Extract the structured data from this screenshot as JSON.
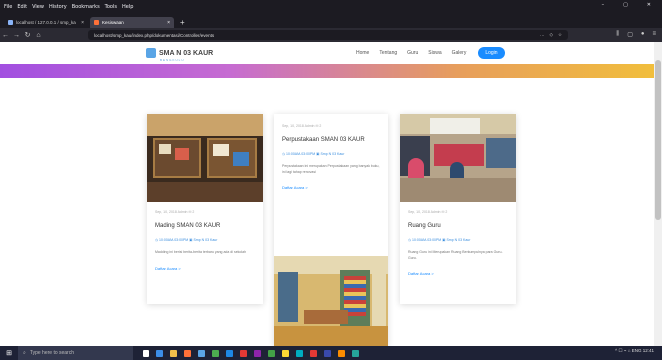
{
  "browser": {
    "menu": [
      "File",
      "Edit",
      "View",
      "History",
      "Bookmarks",
      "Tools",
      "Help"
    ],
    "tabs": [
      {
        "label": "localhost / 127.0.0.1 / smp_ka"
      },
      {
        "label": "Kesiswaan"
      }
    ],
    "url": "localhost/smp_kau/index.php/dokumentasi/Controller/events",
    "window_controls": [
      "–",
      "▢",
      "✕"
    ]
  },
  "site": {
    "logo": "SMA N 03 KAUR",
    "logo_sub": "BENGKULU",
    "nav": [
      "Home",
      "Tentang",
      "Guru",
      "Siswa",
      "Galery"
    ],
    "login": "Login"
  },
  "cards": [
    {
      "meta": "Sep, 10, 2018   Admin  ✉ 2",
      "title": "Mading SMAN 03 KAUR",
      "info": "◷ 10:00AM-03:00PM   ▣ Smp N 03 Kaur",
      "body": "Madding ini berisi berita-berita terbaru yang ada di sekolah",
      "link": "Daftar Acara >"
    },
    {
      "meta": "Sep, 10, 2018   Admin  ✉ 2",
      "title": "Perpustakaan SMAN 03 KAUR",
      "info": "◷ 10:00AM-03:00PM   ▣ Smp N 03 Kaur",
      "body": "Perpustakaan ini merupakan Perpustakaan yang banyak buku, ini lagi tahap renovasi",
      "link": "Daftar Acara >"
    },
    {
      "meta": "Sep, 10, 2018   Admin  ✉ 2",
      "title": "Ruang Guru",
      "info": "◷ 10:00AM-03:00PM   ▣ Smp N 03 Kaur",
      "body": "Ruang Guru ini Merupakan Ruang Berkumpulnya para Guru-Guru.",
      "link": "Daftar Acara >"
    }
  ],
  "taskbar": {
    "search_placeholder": "Type here to search",
    "tray": "^  ☐  ⌁  ⌂  ENG  12:41"
  }
}
